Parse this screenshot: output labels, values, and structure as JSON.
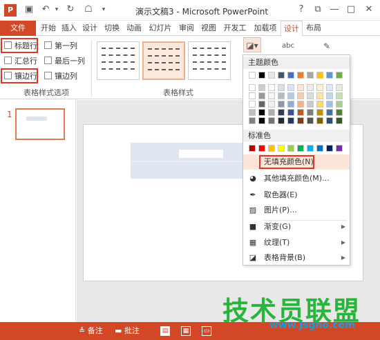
{
  "app": {
    "title": "演示文稿3 - Microsoft PowerPoint",
    "icon_letter": "P"
  },
  "quick_access": {
    "save_icon": "save-icon",
    "undo_icon": "undo-icon",
    "redo_icon": "redo-icon",
    "presenter_icon": "presenter-icon",
    "customize_icon": "customize-icon"
  },
  "window_controls": {
    "help": "?",
    "ribbon_options": "⧉",
    "minimize": "—",
    "maximize": "□",
    "close": "✕"
  },
  "tabs": [
    {
      "label": "文件"
    },
    {
      "label": "开始"
    },
    {
      "label": "插入"
    },
    {
      "label": "设计"
    },
    {
      "label": "切换"
    },
    {
      "label": "动画"
    },
    {
      "label": "幻灯片"
    },
    {
      "label": "审阅"
    },
    {
      "label": "视图"
    },
    {
      "label": "开发工"
    },
    {
      "label": "加载项"
    },
    {
      "label": "设计"
    },
    {
      "label": "布局"
    }
  ],
  "ribbon": {
    "table_style_options": {
      "label": "表格样式选项",
      "checkboxes": [
        "标题行",
        "第一列",
        "汇总行",
        "最后一列",
        "镶边行",
        "镶边列"
      ]
    },
    "table_styles": {
      "label": "表格样式"
    },
    "shading_icon": "paint-bucket-icon",
    "wordart_label": "abc"
  },
  "slides_pane": {
    "slide_number": "1"
  },
  "shading_menu": {
    "theme_colors_label": "主题颜色",
    "standard_colors_label": "标准色",
    "theme_top_row": [
      "#ffffff",
      "#000000",
      "#e7e6e6",
      "#44546a",
      "#4472c4",
      "#ed7d31",
      "#a5a5a5",
      "#ffc000",
      "#5b9bd5",
      "#70ad47"
    ],
    "standard_colors": [
      "#c00000",
      "#ff0000",
      "#ffc000",
      "#ffff00",
      "#92d050",
      "#00b050",
      "#00b0f0",
      "#0070c0",
      "#002060",
      "#7030a0"
    ],
    "items": {
      "no_fill": "无填充颜色(N)",
      "more_colors": "其他填充颜色(M)...",
      "eyedropper": "取色器(E)",
      "picture": "图片(P)...",
      "gradient": "渐变(G)",
      "texture": "纹理(T)",
      "table_background": "表格背景(B)"
    }
  },
  "status_bar": {
    "notes": "备注",
    "comments": "批注"
  },
  "watermark": {
    "text": "技术员联盟",
    "url": "www.jsgho.com"
  }
}
